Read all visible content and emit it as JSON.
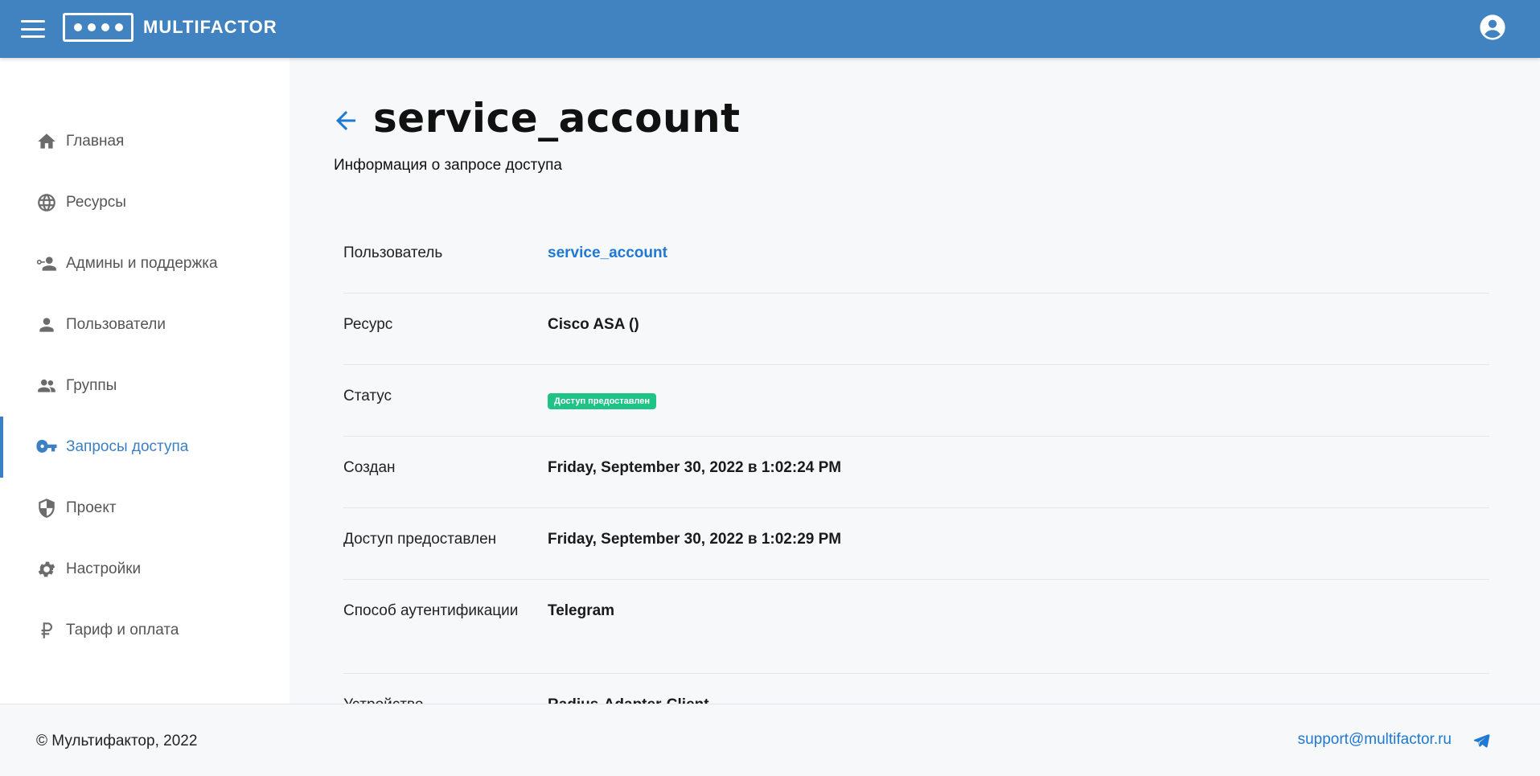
{
  "header": {
    "brand": "MULTIFACTOR",
    "brand_color": "#4183c0"
  },
  "sidebar": {
    "items": [
      {
        "label": "Главная",
        "icon": "home-icon"
      },
      {
        "label": "Ресурсы",
        "icon": "globe-icon"
      },
      {
        "label": "Админы и поддержка",
        "icon": "admin-key-user-icon"
      },
      {
        "label": "Пользователи",
        "icon": "user-icon"
      },
      {
        "label": "Группы",
        "icon": "group-icon"
      },
      {
        "label": "Запросы доступа",
        "icon": "key-icon",
        "active": true
      },
      {
        "label": "Проект",
        "icon": "shield-icon"
      },
      {
        "label": "Настройки",
        "icon": "gear-icon"
      },
      {
        "label": "Тариф и оплата",
        "icon": "ruble-icon"
      }
    ],
    "active_color": "#3b7fc4"
  },
  "main": {
    "title": "service_account",
    "subtitle": "Информация о запросе доступа",
    "details": [
      {
        "label": "Пользователь",
        "value": "service_account"
      },
      {
        "label": "Ресурс",
        "value": "Cisco ASA ()"
      },
      {
        "label": "Статус",
        "value": "Доступ предоставлен"
      },
      {
        "label": "Создан",
        "value": "Friday, September 30, 2022 в 1:02:24 PM"
      },
      {
        "label": "Доступ предоставлен",
        "value": "Friday, September 30, 2022 в 1:02:29 PM"
      },
      {
        "label": "Способ аутентификации",
        "value": "Telegram"
      },
      {
        "label": "Устройство",
        "value": "Radius-Adapter-Client"
      }
    ],
    "status_color": "#20c386",
    "link_color": "#1f78d1"
  },
  "footer": {
    "copyright": "© Мультифактор, 2022",
    "support_email": "support@multifactor.ru"
  }
}
